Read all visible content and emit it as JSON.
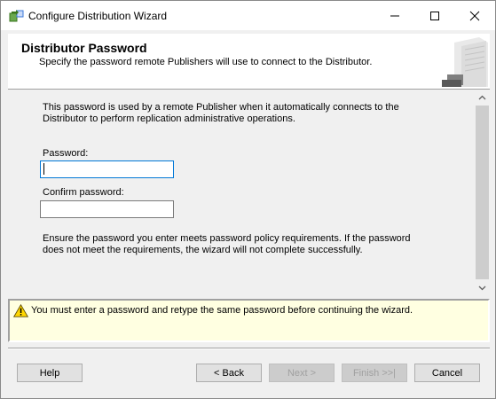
{
  "window": {
    "title": "Configure Distribution Wizard",
    "icon": "wizard-app-icon",
    "controls": [
      "minimize-icon",
      "maximize-icon",
      "close-icon"
    ]
  },
  "header": {
    "title": "Distributor Password",
    "subtitle": "Specify the password remote Publishers will use to connect to the Distributor.",
    "art": "server-icon"
  },
  "content": {
    "intro": "This password is used by a remote Publisher when it automatically connects to the Distributor to perform replication administrative operations.",
    "password_label": "Password:",
    "password_value": "",
    "confirm_label": "Confirm password:",
    "confirm_value": "",
    "policy": "Ensure the password you enter meets password policy requirements. If the password does not meet the requirements, the wizard will not complete successfully."
  },
  "warning": {
    "icon": "warning-icon",
    "text": "You must enter a password and retype the same password before continuing the wizard."
  },
  "buttons": {
    "help": "Help",
    "back": "< Back",
    "next": "Next >",
    "finish": "Finish >>|",
    "cancel": "Cancel"
  },
  "colors": {
    "accent": "#0078d7",
    "warning_bg": "#ffffe1",
    "dialog_bg": "#f0f0f0"
  }
}
